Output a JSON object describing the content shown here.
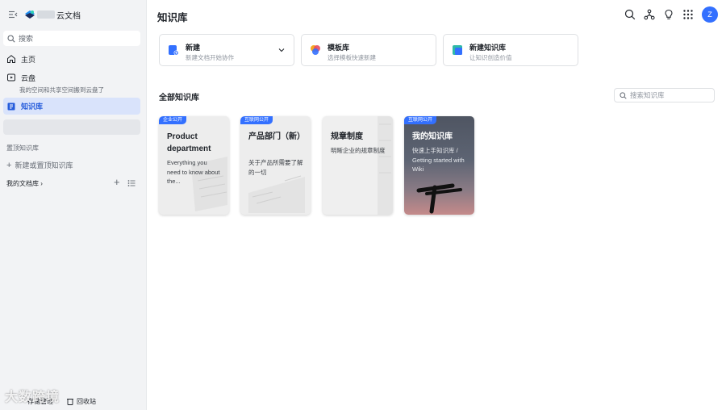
{
  "app": {
    "brand": "云文档"
  },
  "sidebar": {
    "search_placeholder": "搜索",
    "nav": {
      "home": "主页",
      "cloud": "云盘",
      "cloud_sub": "我的空间和共享空间搬到云盘了",
      "wiki": "知识库"
    },
    "pinned_title": "置顶知识库",
    "new_pinned": "新建或置顶知识库",
    "my_docs": "我的文档库",
    "my_docs_arrow": "›",
    "add_symbol": "+",
    "storage": "存储管理",
    "trash": "回收站"
  },
  "watermark": "大数跨境",
  "header": {
    "title": "知识库",
    "avatar": "Z"
  },
  "quick_actions": [
    {
      "title": "新建",
      "subtitle": "新建文档开始协作"
    },
    {
      "title": "模板库",
      "subtitle": "选择模板快速新建"
    },
    {
      "title": "新建知识库",
      "subtitle": "让知识创造价值"
    }
  ],
  "section": {
    "title": "全部知识库",
    "search_placeholder": "搜索知识库"
  },
  "knowledge_cards": [
    {
      "badge": "企业公开",
      "title": "Product department",
      "desc": "Everything you need to know about the..."
    },
    {
      "badge": "互联网公开",
      "title": "产品部门（新）",
      "desc": "关于产品所需要了解的一切"
    },
    {
      "badge": "",
      "title": "规章制度",
      "desc": "明晰企业的规章制度"
    },
    {
      "badge": "互联网公开",
      "title": "我的知识库",
      "desc": "快速上手知识库 / Getting started with Wiki"
    }
  ],
  "colors": {
    "accent": "#3370ff",
    "active_bg": "#d9e3fb",
    "active_text": "#245bdb",
    "sidebar_bg": "#f2f3f5"
  },
  "icons": [
    "collapse-icon",
    "logo-icon",
    "search-icon",
    "home-icon",
    "cloud-drive-icon",
    "wiki-icon",
    "org-icon",
    "bulb-icon",
    "apps-grid-icon",
    "new-doc-icon",
    "template-icon",
    "new-wiki-icon",
    "chevron-down-icon",
    "list-icon",
    "trash-icon"
  ]
}
